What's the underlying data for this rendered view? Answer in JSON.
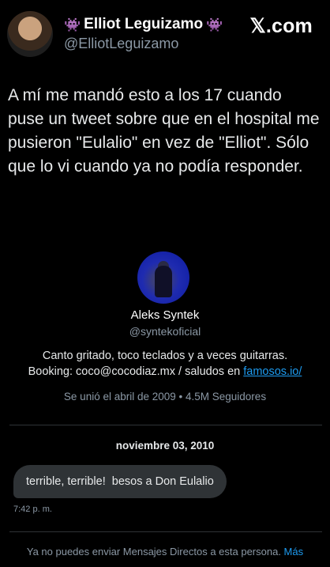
{
  "header": {
    "name": "Elliot Leguizamo",
    "handle": "@ElliotLeguizamo",
    "site": "𝕏.com",
    "emoji_left": "👾",
    "emoji_right": "👾"
  },
  "tweet": {
    "text": "A mí me mandó esto a los 17 cuando puse un tweet sobre que en el hospital me pusieron \"Eulalio\" en vez de \"Elliot\". Sólo que lo vi cuando ya no podía responder."
  },
  "profile": {
    "name": "Aleks Syntek",
    "handle": "@syntekoficial",
    "bio_line1": "Canto gritado, toco teclados y a veces guitarras.",
    "bio_line2_prefix": "Booking: coco@cocodiaz.mx / saludos en ",
    "bio_link": "famosos.io/",
    "joined": "Se unió el abril de 2009 • 4.5M Seguidores"
  },
  "conversation": {
    "date": "noviembre 03, 2010",
    "message": "terrible, terrible!  besos a Don Eulalio",
    "time": "7:42 p. m.",
    "footer": "Ya no puedes enviar Mensajes Directos a esta persona. ",
    "footer_link": "Más"
  },
  "colors": {
    "background": "#000000",
    "accent": "#1d9bf0",
    "bubble": "#2f3336",
    "muted": "#8b98a5"
  }
}
